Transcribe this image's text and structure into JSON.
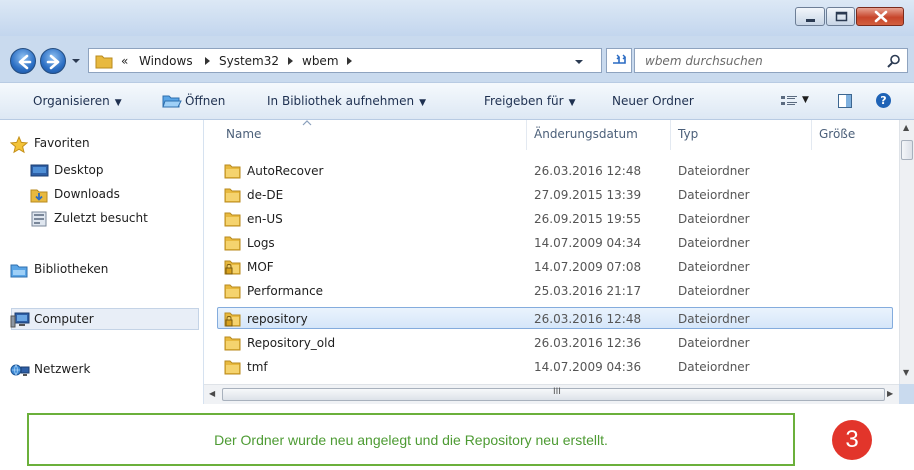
{
  "address": {
    "overflow": "«",
    "crumbs": [
      "Windows",
      "System32",
      "wbem"
    ]
  },
  "search": {
    "placeholder": "wbem durchsuchen"
  },
  "toolbar": {
    "organize": "Organisieren",
    "open": "Öffnen",
    "include_library": "In Bibliothek aufnehmen",
    "share": "Freigeben für",
    "new_folder": "Neuer Ordner"
  },
  "navigation": {
    "favorites": "Favoriten",
    "desktop": "Desktop",
    "downloads": "Downloads",
    "recent": "Zuletzt besucht",
    "libraries": "Bibliotheken",
    "computer": "Computer",
    "network": "Netzwerk"
  },
  "columns": {
    "name": "Name",
    "date": "Änderungsdatum",
    "type": "Typ",
    "size": "Größe"
  },
  "files": [
    {
      "name": "AutoRecover",
      "date": "26.03.2016 12:48",
      "type": "Dateiordner",
      "locked": false,
      "selected": false
    },
    {
      "name": "de-DE",
      "date": "27.09.2015 13:39",
      "type": "Dateiordner",
      "locked": false,
      "selected": false
    },
    {
      "name": "en-US",
      "date": "26.09.2015 19:55",
      "type": "Dateiordner",
      "locked": false,
      "selected": false
    },
    {
      "name": "Logs",
      "date": "14.07.2009 04:34",
      "type": "Dateiordner",
      "locked": false,
      "selected": false
    },
    {
      "name": "MOF",
      "date": "14.07.2009 07:08",
      "type": "Dateiordner",
      "locked": true,
      "selected": false
    },
    {
      "name": "Performance",
      "date": "25.03.2016 21:17",
      "type": "Dateiordner",
      "locked": false,
      "selected": false
    },
    {
      "name": "repository",
      "date": "26.03.2016 12:48",
      "type": "Dateiordner",
      "locked": true,
      "selected": true
    },
    {
      "name": "Repository_old",
      "date": "26.03.2016 12:36",
      "type": "Dateiordner",
      "locked": false,
      "selected": false
    },
    {
      "name": "tmf",
      "date": "14.07.2009 04:36",
      "type": "Dateiordner",
      "locked": false,
      "selected": false
    }
  ],
  "hscroll_grip": "III",
  "caption": "Der Ordner wurde neu angelegt und die Repository neu erstellt.",
  "step": "3",
  "colors": {
    "caption_green": "#4d9b33",
    "caption_border": "#6bb03b",
    "badge_red": "#e2352b",
    "selection": "#d5e6f9",
    "folder": "#e8b93f"
  }
}
